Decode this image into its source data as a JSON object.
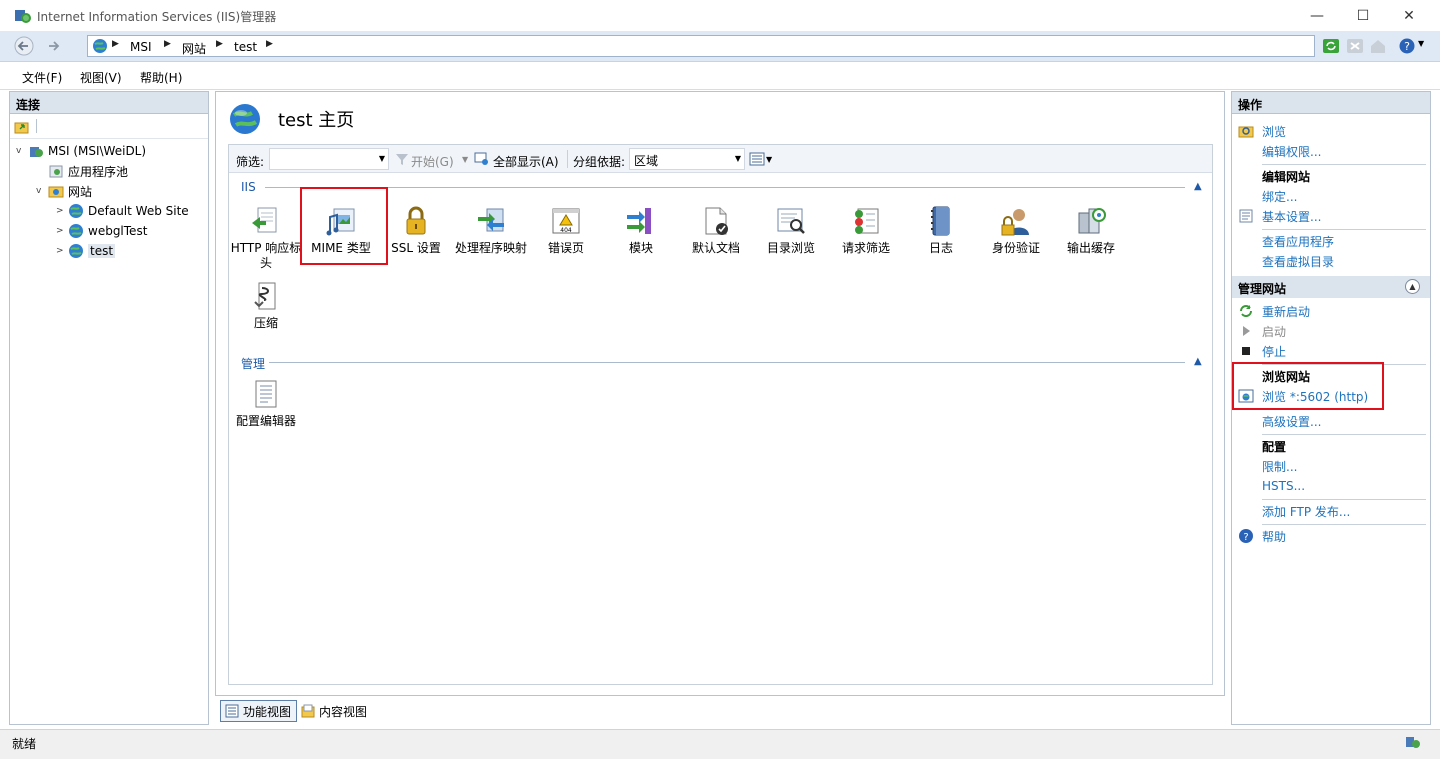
{
  "window": {
    "title": "Internet Information Services (IIS)管理器",
    "minimize": "—",
    "maximize": "☐",
    "close": "✕"
  },
  "address": {
    "crumbs": [
      "MSI",
      "网站",
      "test"
    ]
  },
  "menu": [
    "文件(F)",
    "视图(V)",
    "帮助(H)"
  ],
  "connections": {
    "title": "连接",
    "tree": [
      {
        "label": "MSI (MSI\\WeiDL)",
        "level": 0,
        "expander": "v"
      },
      {
        "label": "应用程序池",
        "level": 1,
        "expander": ""
      },
      {
        "label": "网站",
        "level": 1,
        "expander": "v"
      },
      {
        "label": "Default Web Site",
        "level": 2,
        "expander": ">"
      },
      {
        "label": "webglTest",
        "level": 2,
        "expander": ">"
      },
      {
        "label": "test",
        "level": 2,
        "expander": ">"
      }
    ]
  },
  "center": {
    "title": "test 主页",
    "filter_label": "筛选:",
    "filter_value": "",
    "start_label": "开始(G)",
    "show_all_label": "全部显示(A)",
    "group_by_label": "分组依据:",
    "group_by_value": "区域",
    "groups": [
      {
        "name": "IIS",
        "features": [
          {
            "label": "HTTP 响应标头"
          },
          {
            "label": "MIME 类型"
          },
          {
            "label": "SSL 设置"
          },
          {
            "label": "处理程序映射"
          },
          {
            "label": "错误页"
          },
          {
            "label": "模块"
          },
          {
            "label": "默认文档"
          },
          {
            "label": "目录浏览"
          },
          {
            "label": "请求筛选"
          },
          {
            "label": "日志"
          },
          {
            "label": "身份验证"
          },
          {
            "label": "输出缓存"
          },
          {
            "label": "压缩"
          }
        ]
      },
      {
        "name": "管理",
        "features": [
          {
            "label": "配置编辑器"
          }
        ]
      }
    ]
  },
  "view_tabs": [
    "功能视图",
    "内容视图"
  ],
  "actions": {
    "title": "操作",
    "items": {
      "browse": "浏览",
      "edit_permissions": "编辑权限...",
      "edit_site": "编辑网站",
      "bindings": "绑定...",
      "basic_settings": "基本设置...",
      "view_apps": "查看应用程序",
      "view_vdirs": "查看虚拟目录",
      "manage_site": "管理网站",
      "restart": "重新启动",
      "start": "启动",
      "stop": "停止",
      "browse_site": "浏览网站",
      "browse_port": "浏览 *:5602 (http)",
      "advanced": "高级设置...",
      "config": "配置",
      "limits": "限制...",
      "hsts": "HSTS...",
      "add_ftp": "添加 FTP 发布...",
      "help": "帮助"
    }
  },
  "status": {
    "text": "就绪"
  },
  "colors": {
    "accent_link": "#1e73be",
    "highlight_box": "#e0101c",
    "panel_header": "#dbe3ec"
  }
}
